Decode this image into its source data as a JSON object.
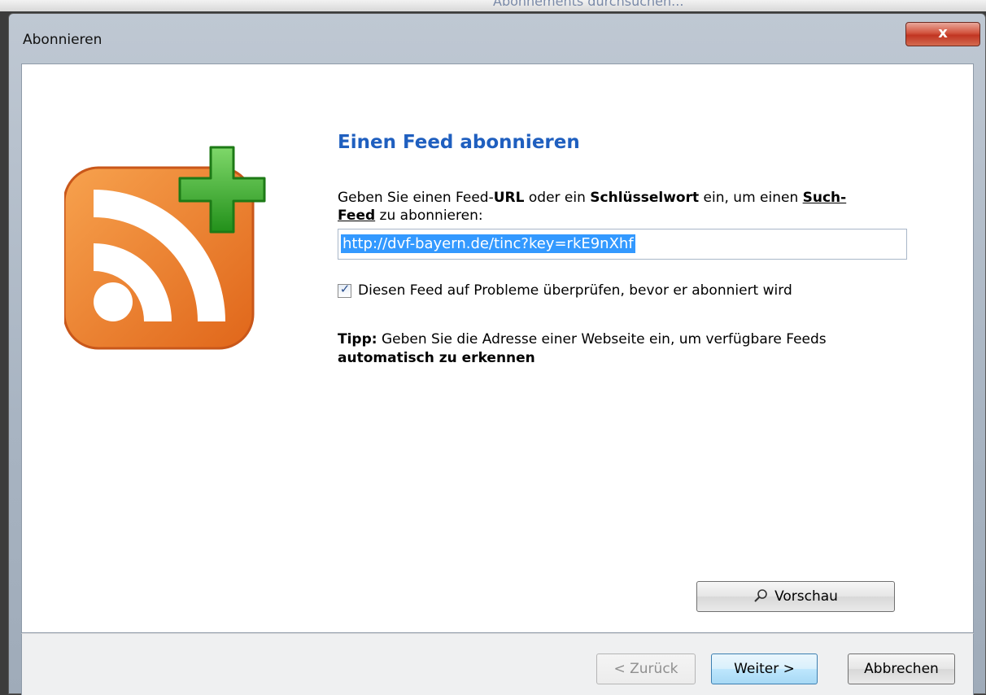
{
  "background": {
    "partial_text": "Abonnements durchsuchen..."
  },
  "window": {
    "title": "Abonnieren",
    "close_label": "x"
  },
  "main": {
    "heading": "Einen Feed abonnieren",
    "description": {
      "part1": "Geben Sie einen Feed-",
      "url": "URL",
      "part2": " oder ein ",
      "keyword": "Schlüsselwort",
      "part3": " ein, um einen ",
      "search_feed": "Such-Feed",
      "part4": " zu abonnieren:"
    },
    "url_value": "http://dvf-bayern.de/tinc?key=rkE9nXhf",
    "check_label": "Diesen Feed auf Probleme überprüfen, bevor er abonniert wird",
    "check_checked": true,
    "tip": {
      "label": "Tipp:",
      "text": " Geben Sie die Adresse einer Webseite ein, um verfügbare Feeds ",
      "bold_end": "automatisch zu erkennen"
    },
    "preview_label": "Vorschau"
  },
  "footer": {
    "back_label": "< Zurück",
    "next_label": "Weiter >",
    "cancel_label": "Abbrechen"
  },
  "colors": {
    "heading": "#1f5fbf",
    "rss_orange": "#f08a2c",
    "plus_green": "#3fb52c",
    "selection": "#3399ff"
  },
  "icons": {
    "logo": "rss-feed-add-icon",
    "preview": "magnifier-icon",
    "check": "checkmark-icon"
  }
}
